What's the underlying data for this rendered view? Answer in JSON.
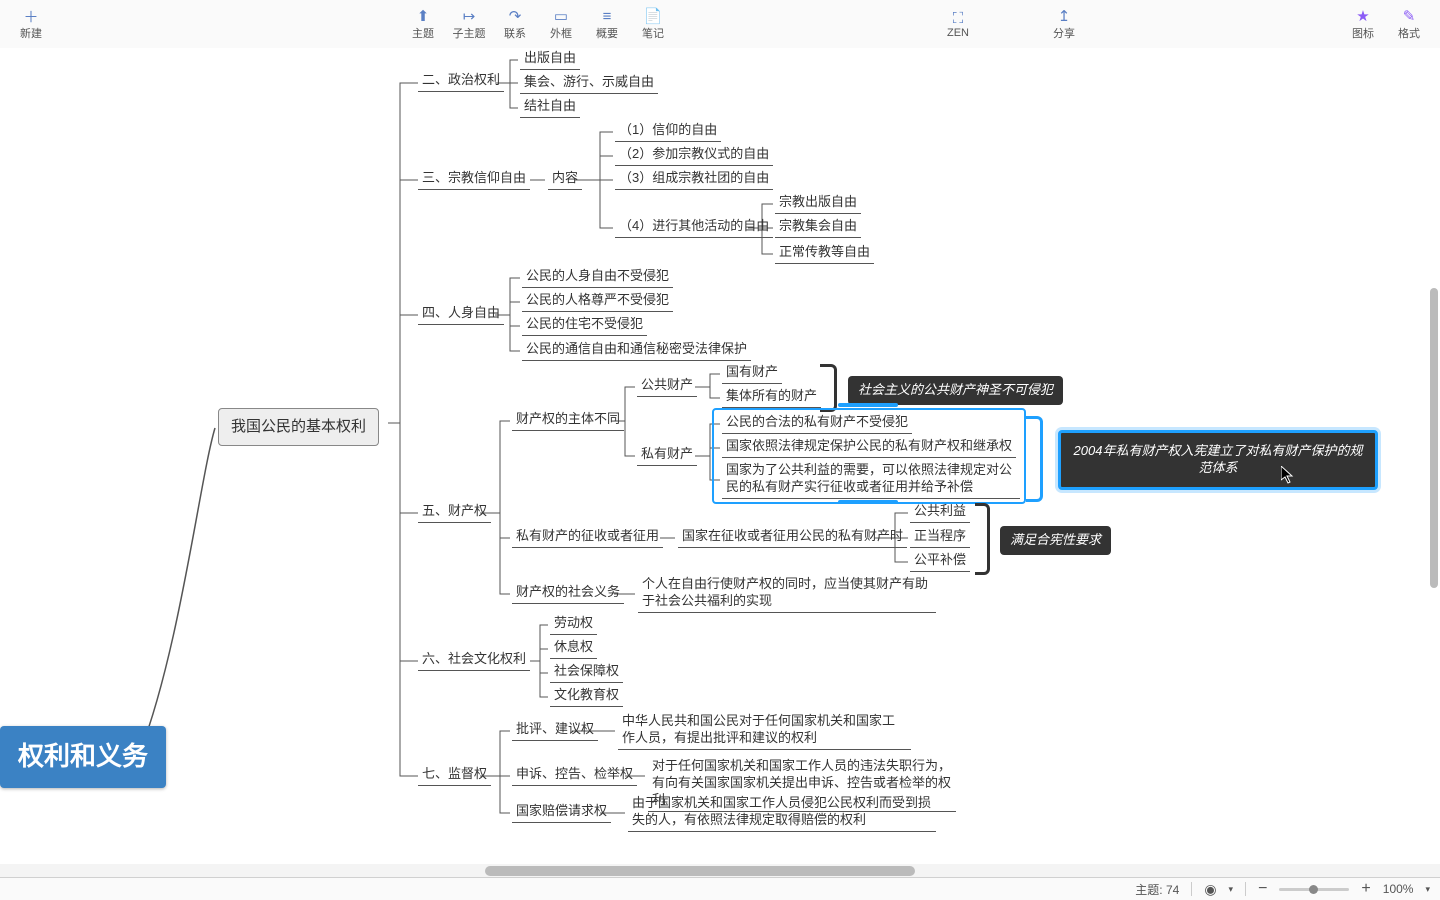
{
  "toolbar": {
    "left": [
      {
        "icon": "＋",
        "label": "新建"
      }
    ],
    "center1": [
      {
        "icon": "⬆",
        "label": "主题"
      },
      {
        "icon": "↦",
        "label": "子主题"
      },
      {
        "icon": "↷",
        "label": "联系"
      },
      {
        "icon": "▭",
        "label": "外框"
      },
      {
        "icon": "≡",
        "label": "概要"
      },
      {
        "icon": "📄",
        "label": "笔记"
      }
    ],
    "center2": [
      {
        "icon": "⛶",
        "label": "ZEN"
      },
      {
        "icon": "↥",
        "label": "分享"
      }
    ],
    "right": [
      {
        "icon": "★",
        "label": "图标"
      },
      {
        "icon": "✎",
        "label": "格式"
      }
    ]
  },
  "root": "权利和义务",
  "hub": "我国公民的基本权利",
  "branches": {
    "b2": {
      "label": "二、政治权利",
      "items": [
        "出版自由",
        "集会、游行、示威自由",
        "结社自由"
      ]
    },
    "b3": {
      "label": "三、宗教信仰自由",
      "sub": "内容",
      "items": [
        "（1）信仰的自由",
        "（2）参加宗教仪式的自由",
        "（3）组成宗教社团的自由"
      ],
      "b34": "（4）进行其他活动的自由",
      "b34items": [
        "宗教出版自由",
        "宗教集会自由",
        "正常传教等自由"
      ]
    },
    "b4": {
      "label": "四、人身自由",
      "items": [
        "公民的人身自由不受侵犯",
        "公民的人格尊严不受侵犯",
        "公民的住宅不受侵犯",
        "公民的通信自由和通信秘密受法律保护"
      ]
    },
    "b5": {
      "label": "五、财产权",
      "s1": {
        "label": "财产权的主体不同",
        "pub": {
          "label": "公共财产",
          "items": [
            "国有财产",
            "集体所有的财产"
          ],
          "note": "社会主义的公共财产神圣不可侵犯"
        },
        "pri": {
          "label": "私有财产",
          "items": [
            "公民的合法的私有财产不受侵犯",
            "国家依照法律规定保护公民的私有财产权和继承权",
            "国家为了公共利益的需要，可以依照法律规定对公民的私有财产实行征收或者征用并给予补偿"
          ],
          "note": "2004年私有财产权入宪建立了对私有财产保护的规范体系"
        }
      },
      "s2": {
        "label": "私有财产的征收或者征用",
        "mid": "国家在征收或者征用公民的私有财产时",
        "items": [
          "公共利益",
          "正当程序",
          "公平补偿"
        ],
        "note": "满足合宪性要求"
      },
      "s3": {
        "label": "财产权的社会义务",
        "text": "个人在自由行使财产权的同时，应当使其财产有助于社会公共福利的实现"
      }
    },
    "b6": {
      "label": "六、社会文化权利",
      "items": [
        "劳动权",
        "休息权",
        "社会保障权",
        "文化教育权"
      ]
    },
    "b7": {
      "label": "七、监督权",
      "items": [
        {
          "l": "批评、建议权",
          "r": "中华人民共和国公民对于任何国家机关和国家工作人员，有提出批评和建议的权利"
        },
        {
          "l": "申诉、控告、检举权",
          "r": "对于任何国家机关和国家工作人员的违法失职行为，有向有关国家国家机关提出申诉、控告或者检举的权利"
        },
        {
          "l": "国家赔偿请求权",
          "r": "由于国家机关和国家工作人员侵犯公民权利而受到损失的人，有依照法律规定取得赔偿的权利"
        }
      ]
    }
  },
  "status": {
    "topic_label": "主题:",
    "topic_count": "74",
    "zoom": "100%"
  }
}
